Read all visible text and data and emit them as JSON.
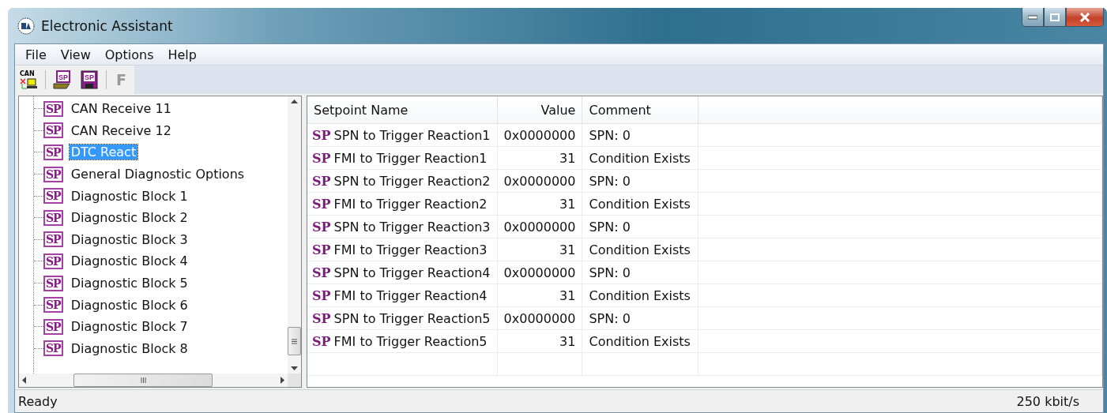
{
  "window": {
    "title": "Electronic Assistant"
  },
  "menu": [
    "File",
    "View",
    "Options",
    "Help"
  ],
  "toolbar": [
    {
      "kind": "can",
      "label": "CAN",
      "disabled": false
    },
    {
      "kind": "open",
      "label": "SP",
      "disabled": false
    },
    {
      "kind": "save",
      "label": "SP",
      "disabled": false
    },
    {
      "kind": "letter",
      "label": "F",
      "disabled": true
    }
  ],
  "tree": {
    "items": [
      {
        "label": "CAN Receive 11",
        "badge": "SP",
        "selected": false
      },
      {
        "label": "CAN Receive 12",
        "badge": "SP",
        "selected": false
      },
      {
        "label": "DTC React",
        "badge": "SP",
        "selected": true
      },
      {
        "label": "General Diagnostic Options",
        "badge": "SP",
        "selected": false
      },
      {
        "label": "Diagnostic Block 1",
        "badge": "SP",
        "selected": false
      },
      {
        "label": "Diagnostic Block 2",
        "badge": "SP",
        "selected": false
      },
      {
        "label": "Diagnostic Block 3",
        "badge": "SP",
        "selected": false
      },
      {
        "label": "Diagnostic Block 4",
        "badge": "SP",
        "selected": false
      },
      {
        "label": "Diagnostic Block 5",
        "badge": "SP",
        "selected": false
      },
      {
        "label": "Diagnostic Block 6",
        "badge": "SP",
        "selected": false
      },
      {
        "label": "Diagnostic Block 7",
        "badge": "SP",
        "selected": false
      },
      {
        "label": "Diagnostic Block 8",
        "badge": "SP",
        "selected": false
      }
    ]
  },
  "table": {
    "columns": [
      "Setpoint Name",
      "Value",
      "Comment"
    ],
    "rows": [
      {
        "badge": "SP",
        "name": "SPN to Trigger Reaction1",
        "value": "0x0000000",
        "comment": "SPN: 0"
      },
      {
        "badge": "SP",
        "name": "FMI to Trigger Reaction1",
        "value": "31",
        "comment": "Condition Exists"
      },
      {
        "badge": "SP",
        "name": "SPN to Trigger Reaction2",
        "value": "0x0000000",
        "comment": "SPN: 0"
      },
      {
        "badge": "SP",
        "name": "FMI to Trigger Reaction2",
        "value": "31",
        "comment": "Condition Exists"
      },
      {
        "badge": "SP",
        "name": "SPN to Trigger Reaction3",
        "value": "0x0000000",
        "comment": "SPN: 0"
      },
      {
        "badge": "SP",
        "name": "FMI to Trigger Reaction3",
        "value": "31",
        "comment": "Condition Exists"
      },
      {
        "badge": "SP",
        "name": "SPN to Trigger Reaction4",
        "value": "0x0000000",
        "comment": "SPN: 0"
      },
      {
        "badge": "SP",
        "name": "FMI to Trigger Reaction4",
        "value": "31",
        "comment": "Condition Exists"
      },
      {
        "badge": "SP",
        "name": "SPN to Trigger Reaction5",
        "value": "0x0000000",
        "comment": "SPN: 0"
      },
      {
        "badge": "SP",
        "name": "FMI to Trigger Reaction5",
        "value": "31",
        "comment": "Condition Exists"
      }
    ]
  },
  "status_bar": {
    "message": "Ready",
    "bitrate": "250 kbit/s"
  }
}
